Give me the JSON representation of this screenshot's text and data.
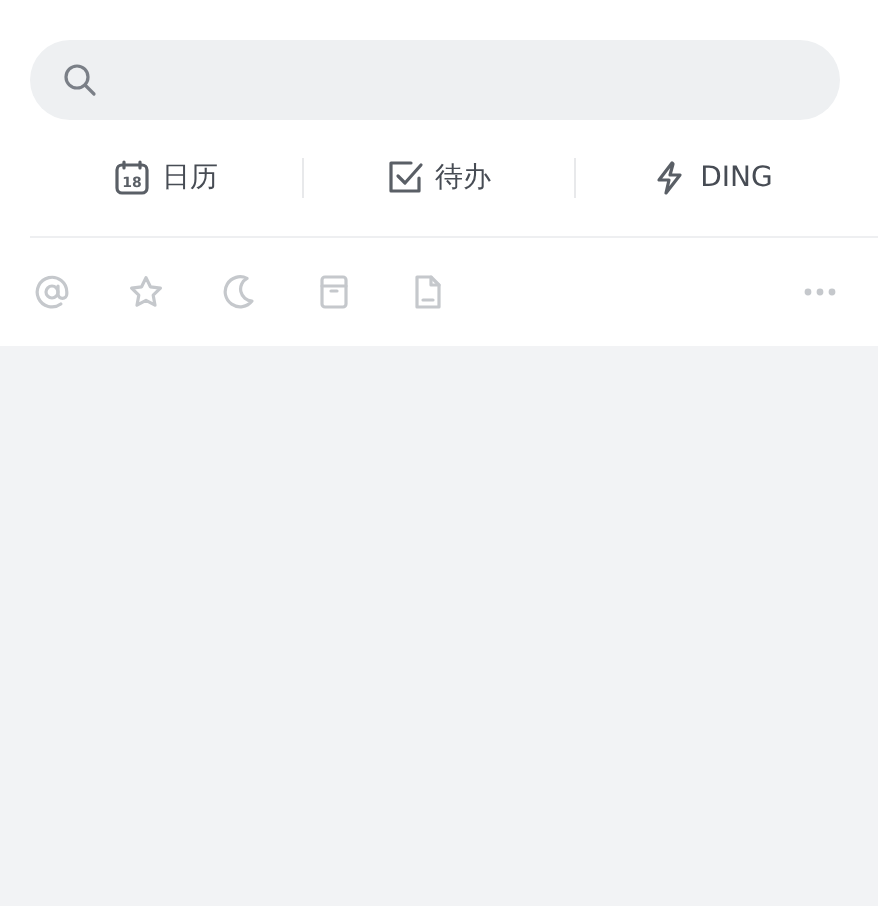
{
  "search": {
    "kind": "search"
  },
  "quick_actions": [
    {
      "kind": "calendar",
      "label": "日历",
      "icon_text": "18"
    },
    {
      "kind": "todo",
      "label": "待办"
    },
    {
      "kind": "ding",
      "label": "DING"
    }
  ],
  "filters": [
    {
      "kind": "at"
    },
    {
      "kind": "star"
    },
    {
      "kind": "moon"
    },
    {
      "kind": "archive"
    },
    {
      "kind": "file"
    },
    {
      "kind": "more"
    }
  ]
}
